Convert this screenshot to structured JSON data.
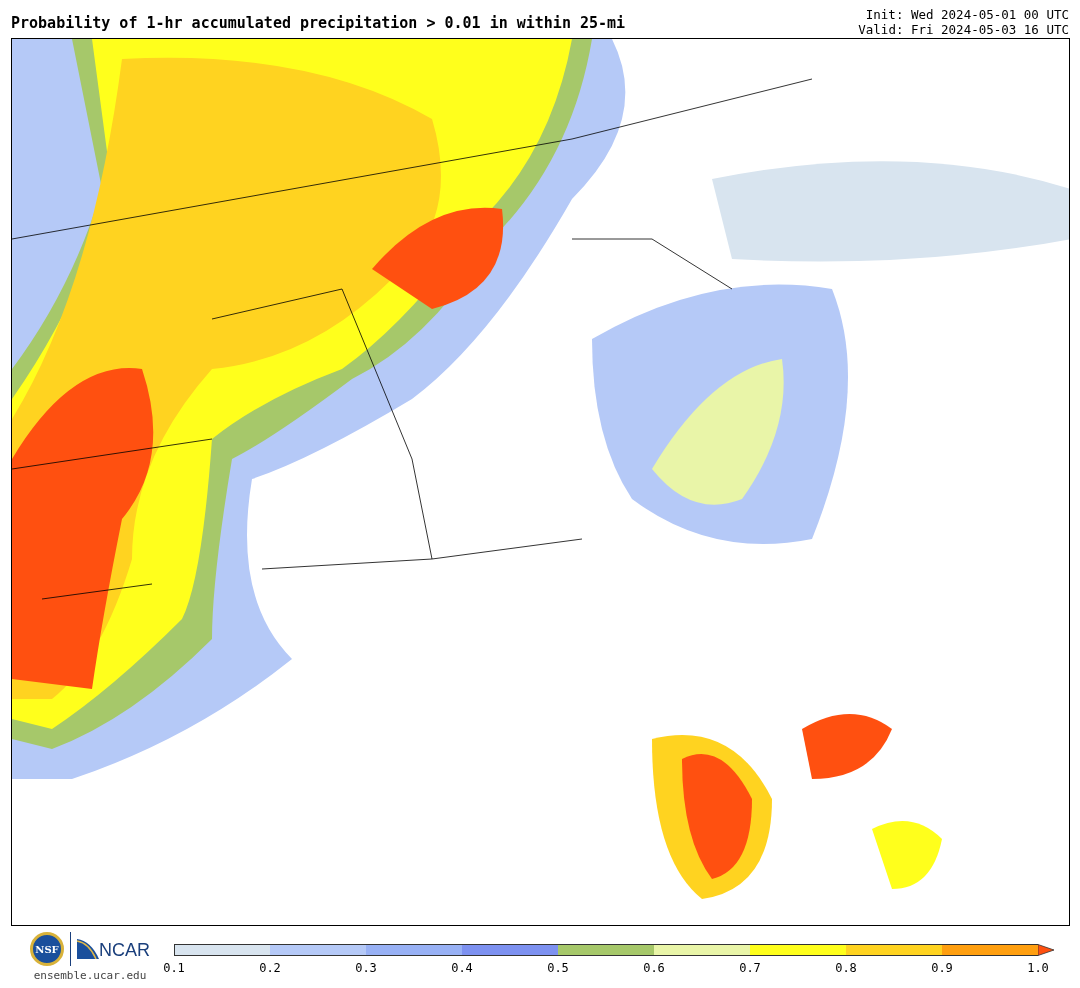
{
  "title": "Probability of 1-hr accumulated precipitation > 0.01 in within 25-mi",
  "init": "Init: Wed 2024-05-01 00 UTC",
  "valid": "Valid: Fri 2024-05-03 16 UTC",
  "logos": {
    "nsf": "NSF",
    "ncar": "NCAR"
  },
  "site": "ensemble.ucar.edu",
  "colorbar": {
    "bins": [
      {
        "color": "#d8e4ef"
      },
      {
        "color": "#b5c9f7"
      },
      {
        "color": "#98b1f5"
      },
      {
        "color": "#7d91f0"
      },
      {
        "color": "#a6c86a"
      },
      {
        "color": "#e9f5a8"
      },
      {
        "color": "#ffff1c"
      },
      {
        "color": "#ffd320"
      },
      {
        "color": "#ff9f10"
      }
    ],
    "extend": {
      "color": "#ff5010"
    },
    "ticks": [
      "0.1",
      "0.2",
      "0.3",
      "0.4",
      "0.5",
      "0.6",
      "0.7",
      "0.8",
      "0.9",
      "1.0"
    ]
  }
}
